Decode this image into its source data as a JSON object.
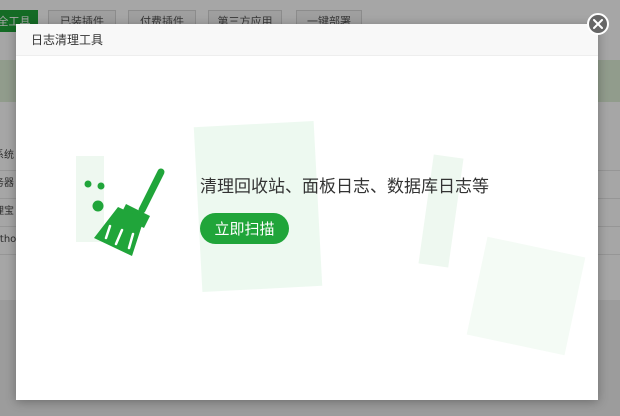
{
  "background": {
    "tabs": [
      "全工具",
      "已装插件",
      "付费插件",
      "第三方应用",
      "一键部署"
    ],
    "rows": [
      "系统",
      "务器",
      "理宝",
      "ytho"
    ]
  },
  "modal": {
    "title": "日志清理工具",
    "headline": "清理回收站、面板日志、数据库日志等",
    "scan_button": "立即扫描",
    "icon": "broom-icon",
    "close_icon": "close-icon"
  },
  "colors": {
    "accent": "#20a53a",
    "header_bg": "#f8f8f8",
    "close_bg": "#666666"
  }
}
